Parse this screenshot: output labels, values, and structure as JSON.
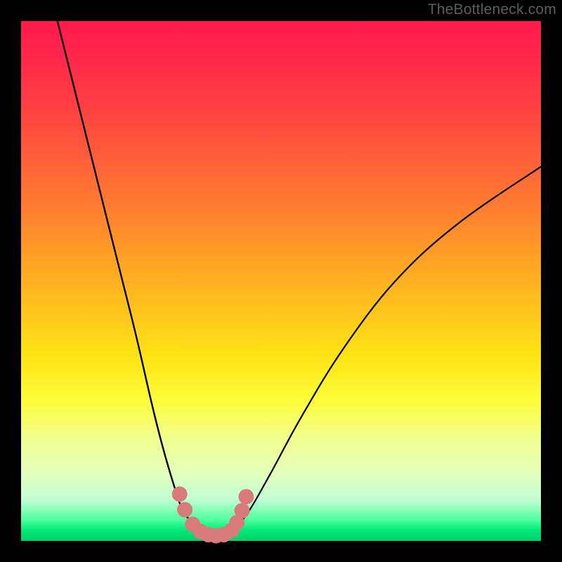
{
  "watermark": "TheBottleneck.com",
  "chart_data": {
    "type": "line",
    "title": "",
    "xlabel": "",
    "ylabel": "",
    "xlim": [
      0,
      100
    ],
    "ylim": [
      0,
      100
    ],
    "grid": false,
    "legend": false,
    "series": [
      {
        "name": "left-branch",
        "x": [
          7,
          10,
          14,
          18,
          22,
          25,
          27,
          29,
          31,
          32.5,
          34
        ],
        "y": [
          100,
          88,
          72,
          56,
          40,
          27,
          19,
          12,
          6,
          4,
          2
        ]
      },
      {
        "name": "right-branch",
        "x": [
          41,
          44,
          48,
          54,
          62,
          72,
          84,
          100
        ],
        "y": [
          2,
          6,
          13,
          24,
          37,
          50,
          61,
          72
        ]
      },
      {
        "name": "valley-floor",
        "x": [
          34,
          36,
          38,
          40,
          41
        ],
        "y": [
          2,
          1,
          1,
          1.2,
          2
        ]
      }
    ],
    "markers": {
      "name": "highlight-dots",
      "color": "#d97b7b",
      "points": [
        {
          "x": 30.5,
          "y": 9
        },
        {
          "x": 31.5,
          "y": 6
        },
        {
          "x": 33.0,
          "y": 3.2
        },
        {
          "x": 34.5,
          "y": 1.8
        },
        {
          "x": 36.0,
          "y": 1.2
        },
        {
          "x": 37.5,
          "y": 1.0
        },
        {
          "x": 39.0,
          "y": 1.2
        },
        {
          "x": 40.5,
          "y": 2.0
        },
        {
          "x": 41.5,
          "y": 3.5
        },
        {
          "x": 42.5,
          "y": 5.8
        },
        {
          "x": 43.3,
          "y": 8.5
        }
      ]
    }
  }
}
